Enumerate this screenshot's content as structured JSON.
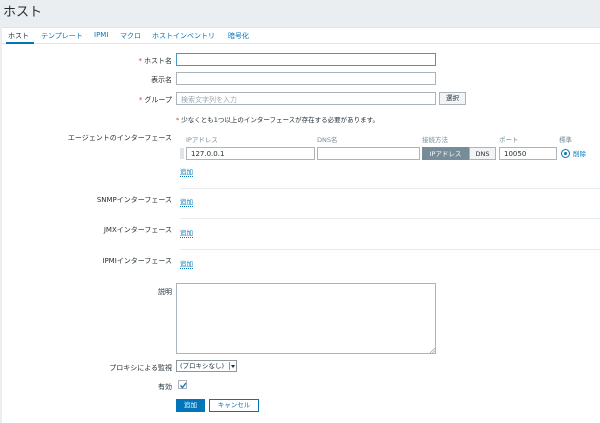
{
  "page_title": "ホスト",
  "tabs": [
    {
      "label": "ホスト"
    },
    {
      "label": "テンプレート"
    },
    {
      "label": "IPMI"
    },
    {
      "label": "マクロ"
    },
    {
      "label": "ホストインベントリ"
    },
    {
      "label": "暗号化"
    }
  ],
  "form": {
    "host_name_label": "ホスト名",
    "host_name_value": "",
    "visible_name_label": "表示名",
    "visible_name_value": "",
    "groups_label": "グループ",
    "groups_placeholder": "検索文字列を入力",
    "select_button": "選択",
    "interface_note": "少なくとも1つ以上のインターフェースが存在する必要があります。",
    "agent_interfaces_label": "エージェントのインターフェース",
    "columns": {
      "ip": "IPアドレス",
      "dns": "DNS名",
      "connect_to": "接続方法",
      "port": "ポート",
      "default": "標準"
    },
    "agent_interface": {
      "ip": "127.0.0.1",
      "dns": "",
      "connect_ip": "IPアドレス",
      "connect_dns": "DNS",
      "port": "10050",
      "remove": "削除"
    },
    "add_link": "追加",
    "snmp_label": "SNMPインターフェース",
    "jmx_label": "JMXインターフェース",
    "ipmi_label": "IPMIインターフェース",
    "description_label": "説明",
    "description_value": "",
    "proxy_label": "プロキシによる監視",
    "proxy_value": "(プロキシなし)",
    "enabled_label": "有効",
    "enabled": true,
    "submit_button": "追加",
    "cancel_button": "キャンセル"
  },
  "colors": {
    "accent": "#0275b8",
    "required": "#e33734",
    "background": "#ebeef0"
  }
}
